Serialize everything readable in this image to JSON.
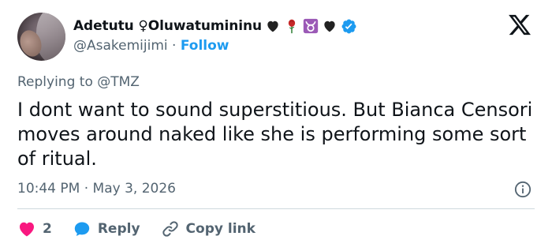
{
  "tweet": {
    "author": {
      "display_name": "Adetutu ♀Oluwatumininu",
      "emoji_badges": [
        "black-heart-icon",
        "rose-icon",
        "taurus-icon",
        "black-heart-icon"
      ],
      "verified": true,
      "handle": "@Asakemijimi",
      "separator": "·",
      "follow_label": "Follow"
    },
    "replying_prefix": "Replying to",
    "replying_to": "@TMZ",
    "text": "I dont want to sound superstitious. But Bianca Censori moves around naked like she is performing some sort of ritual.",
    "timestamp": "10:44 PM · May 3, 2026",
    "actions": {
      "like_count": "2",
      "reply_label": "Reply",
      "copy_link_label": "Copy link"
    },
    "colors": {
      "accent": "#1d9bf0",
      "like": "#f91880",
      "text": "#0f1419",
      "muted": "#536471",
      "taurus_badge": "#9b59b6"
    }
  }
}
